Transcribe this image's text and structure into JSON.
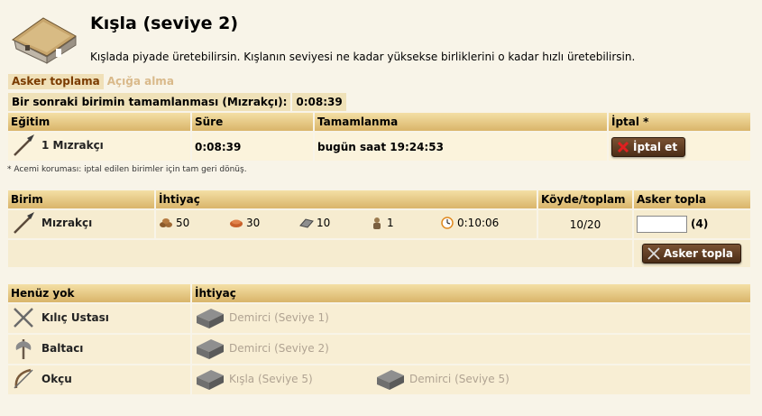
{
  "header": {
    "title": "Kışla (seviye 2)",
    "description": "Kışlada piyade üretebilirsin. Kışlanın seviyesi ne kadar yüksekse birliklerini o kadar hızlı üretebilirsin."
  },
  "tabs": [
    {
      "label": "Asker toplama",
      "active": true
    },
    {
      "label": "Açığa alma",
      "active": false
    }
  ],
  "next_unit": {
    "label": "Bir sonraki birimin tamamlanması (Mızrakçı):",
    "time": "0:08:39"
  },
  "queue": {
    "headers": {
      "training": "Eğitim",
      "duration": "Süre",
      "completion": "Tamamlanma",
      "cancel": "İptal *"
    },
    "rows": [
      {
        "unit": "1 Mızrakçı",
        "duration": "0:08:39",
        "completion": "bugün saat 19:24:53",
        "cancel_label": "İptal et"
      }
    ],
    "note": "* Acemi koruması: iptal edilen birimler için tam geri dönüş."
  },
  "recruit": {
    "headers": {
      "unit": "Birim",
      "requirement": "İhtiyaç",
      "village_total": "Köyde/toplam",
      "recruit": "Asker topla"
    },
    "rows": [
      {
        "unit": "Mızrakçı",
        "wood": "50",
        "clay": "30",
        "iron": "10",
        "pop": "1",
        "time": "0:10:06",
        "village_total": "10/20",
        "input_value": "",
        "max": "(4)"
      }
    ],
    "button_label": "Asker topla"
  },
  "unavailable": {
    "headers": {
      "none": "Henüz yok",
      "requirement": "İhtiyaç"
    },
    "rows": [
      {
        "unit": "Kılıç Ustası",
        "reqs": [
          "Demirci (Seviye 1)"
        ]
      },
      {
        "unit": "Baltacı",
        "reqs": [
          "Demirci (Seviye 2)"
        ]
      },
      {
        "unit": "Okçu",
        "reqs": [
          "Kışla (Seviye 5)",
          "Demirci (Seviye 5)"
        ]
      }
    ]
  },
  "colors": {
    "header_bg": "#d9b56a",
    "row_bg": "#f6ecd0",
    "button_bg": "#5e3a20",
    "tab_active": "#7a3b00"
  }
}
